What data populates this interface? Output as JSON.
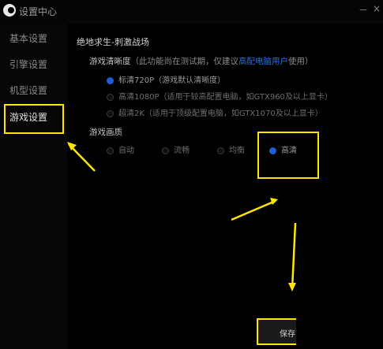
{
  "window": {
    "title": "设置中心",
    "minimize": "－",
    "close": "×"
  },
  "sidebar": {
    "items": [
      {
        "label": "基本设置"
      },
      {
        "label": "引擎设置"
      },
      {
        "label": "机型设置"
      },
      {
        "label": "游戏设置",
        "active": true
      }
    ]
  },
  "main": {
    "game_title": "绝地求生-刺激战场",
    "clarity": {
      "label": "游戏清晰度",
      "note_before": "（此功能尚在测试期，仅建议",
      "link": "高配电脑用户",
      "note_after": "使用）",
      "options": [
        {
          "label": "标清720P（游戏默认清晰度）",
          "selected": true
        },
        {
          "label": "高清1080P（适用于较高配置电脑，如GTX960及以上显卡）",
          "selected": false
        },
        {
          "label": "超清2K（适用于顶级配置电脑，如GTX1070及以上显卡）",
          "selected": false
        }
      ]
    },
    "quality": {
      "label": "游戏画质",
      "options": [
        {
          "label": "自动",
          "selected": false
        },
        {
          "label": "流畅",
          "selected": false
        },
        {
          "label": "均衡",
          "selected": false
        },
        {
          "label": "高清",
          "selected": true
        }
      ]
    },
    "save_label": "保存"
  },
  "colors": {
    "highlight": "#ffe600",
    "accent": "#1e5fd6",
    "background": "#000000"
  }
}
